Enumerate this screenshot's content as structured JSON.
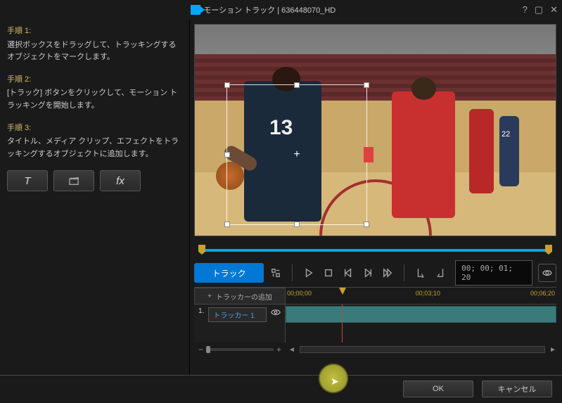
{
  "titlebar": {
    "title": "モーション トラック  |  636448070_HD",
    "help": "?",
    "maximize": "▢",
    "close": "✕"
  },
  "steps": {
    "s1_title": "手順 1:",
    "s1_desc": "選択ボックスをドラッグして、トラッキングするオブジェクトをマークします。",
    "s2_title": "手順 2:",
    "s2_desc": "[トラック] ボタンをクリックして、モーション トラッキングを開始します。",
    "s3_title": "手順 3:",
    "s3_desc": "タイトル、メディア クリップ、エフェクトをトラッキングするオブジェクトに追加します。"
  },
  "tools": {
    "title_btn": "T",
    "fx_btn": "fx"
  },
  "preview": {
    "jersey_number": "13"
  },
  "controls": {
    "track_button": "トラック",
    "timecode": "00; 00; 01; 20"
  },
  "timeline": {
    "add_tracker": "トラッカーの追加",
    "ruler": [
      "00;00;00",
      "00;03;10",
      "00;06;20"
    ],
    "track_index": "1.",
    "tracker_name": "トラッカー 1",
    "zoom_minus": "−",
    "zoom_plus": "+",
    "arrow_left": "◄",
    "arrow_right": "►"
  },
  "footer": {
    "ok": "OK",
    "cancel": "キャンセル"
  }
}
